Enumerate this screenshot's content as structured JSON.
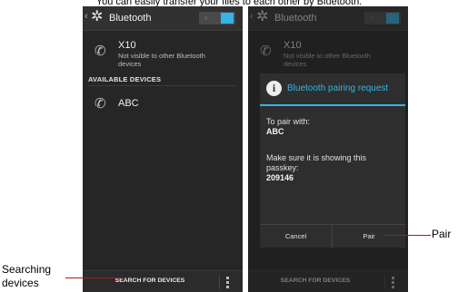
{
  "caption": "You can easily transfer your files to each other by Bluetooth.",
  "left_screen": {
    "title": "Bluetooth",
    "toggle_state": "on",
    "my_device": {
      "name": "X10",
      "status": "Not visible to other Bluetooth devices"
    },
    "section_label": "AVAILABLE DEVICES",
    "devices": [
      {
        "name": "ABC"
      }
    ],
    "bottom_action": "SEARCH FOR DEVICES"
  },
  "right_screen": {
    "title": "Bluetooth",
    "my_device": {
      "name": "X10",
      "status": "Not visible to other Bluetooth devices"
    },
    "bottom_action": "SEARCH FOR DEVICES",
    "dialog": {
      "title": "Bluetooth pairing request",
      "pair_with_label": "To pair with:",
      "device_name": "ABC",
      "instruction": "Make sure it is showing this passkey:",
      "passkey": "209146",
      "cancel_label": "Cancel",
      "pair_label": "Pair"
    }
  },
  "annotations": {
    "search_label": "Searching devices",
    "pair_label": "Pair"
  },
  "colors": {
    "accent": "#33b5e5",
    "pointer": "#b01818"
  }
}
